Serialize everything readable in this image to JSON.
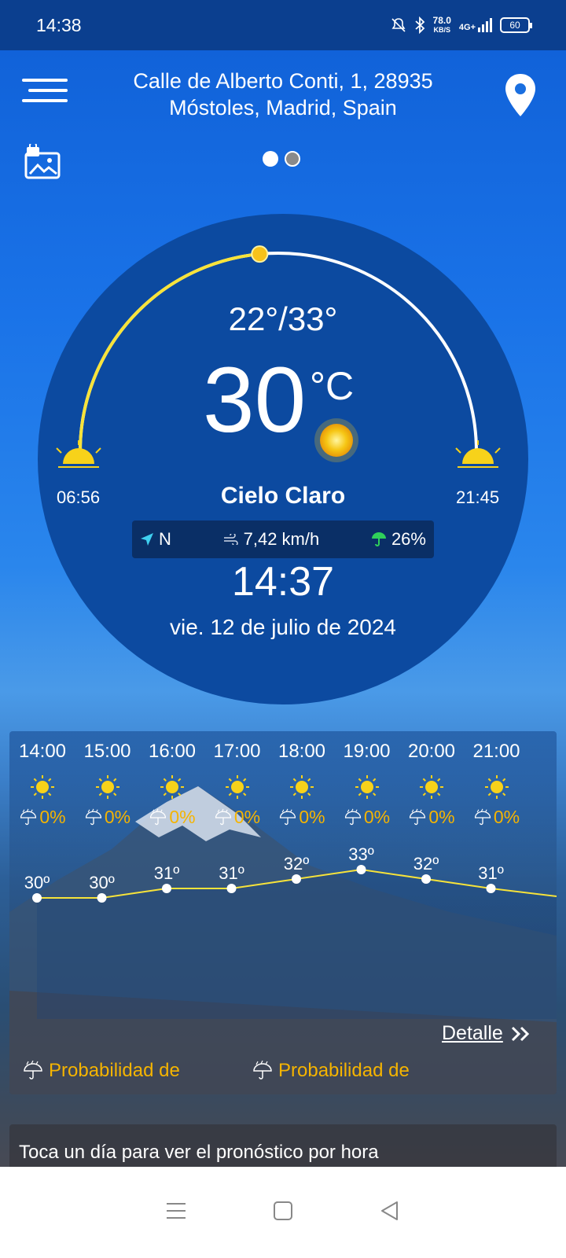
{
  "status_bar": {
    "time": "14:38",
    "speed_value": "78.0",
    "speed_unit": "KB/S",
    "network": "4G+",
    "battery": "60"
  },
  "header": {
    "address_line1": "Calle de Alberto Conti, 1, 28935",
    "address_line2": "Móstoles, Madrid, Spain"
  },
  "pager": {
    "pages": 2,
    "active": 0
  },
  "current": {
    "min_max": "22°/33°",
    "temperature": "30",
    "unit": "°C",
    "condition": "Cielo Claro",
    "sunrise": "06:56",
    "sunset": "21:45",
    "wind_direction": "N",
    "wind_speed": "7,42 km/h",
    "precipitation": "26%",
    "time": "14:37",
    "date": "vie. 12 de julio de 2024",
    "sun_progress": 0.47
  },
  "hourly": {
    "hours": [
      {
        "time": "14:00",
        "precip": "0%",
        "temp": "30º",
        "value": 30
      },
      {
        "time": "15:00",
        "precip": "0%",
        "temp": "30º",
        "value": 30
      },
      {
        "time": "16:00",
        "precip": "0%",
        "temp": "31º",
        "value": 31
      },
      {
        "time": "17:00",
        "precip": "0%",
        "temp": "31º",
        "value": 31
      },
      {
        "time": "18:00",
        "precip": "0%",
        "temp": "32º",
        "value": 32
      },
      {
        "time": "19:00",
        "precip": "0%",
        "temp": "33º",
        "value": 33
      },
      {
        "time": "20:00",
        "precip": "0%",
        "temp": "32º",
        "value": 32
      },
      {
        "time": "21:00",
        "precip": "0%",
        "temp": "31º",
        "value": 31
      }
    ],
    "detail_label": "Detalle",
    "prob_label_1": "Probabilidad de",
    "prob_label_2": "Probabilidad de"
  },
  "footer_note": "Toca un día para ver el pronóstico por hora",
  "colors": {
    "accent_yellow": "#f7e33a",
    "precip_orange": "#f5b400",
    "circle_bg": "#0c4aa0"
  }
}
